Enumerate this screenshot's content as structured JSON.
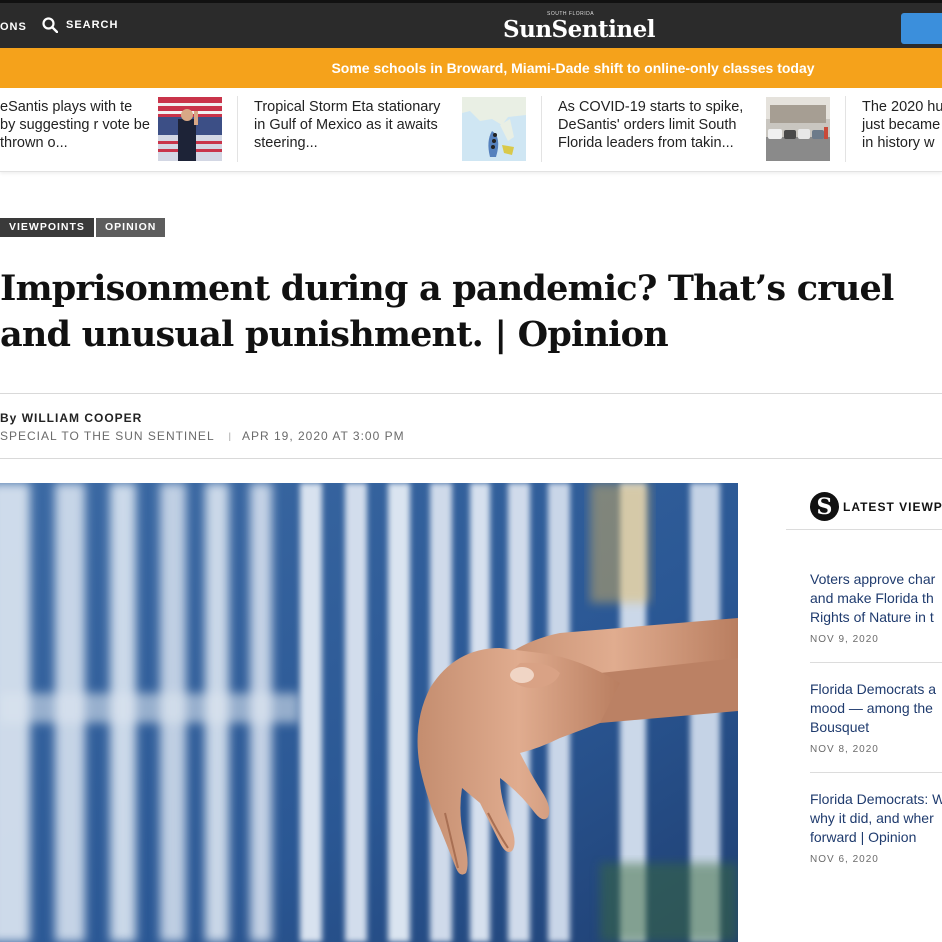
{
  "nav": {
    "sections_label": "ONS",
    "search_label": "SEARCH",
    "logo_tag": "SOUTH FLORIDA",
    "logo_text": "SunSentinel"
  },
  "banner": {
    "text": "Some schools in Broward, Miami-Dade shift to online-only classes today"
  },
  "strip": [
    {
      "text": "eSantis plays with te by suggesting r vote be thrown o..."
    },
    {
      "text": "Tropical Storm Eta stationary in Gulf of Mexico as it awaits steering..."
    },
    {
      "text": "As COVID-19 starts to spike, DeSantis' orders limit South Florida leaders from takin..."
    },
    {
      "text": "The 2020 hu just became in history w"
    }
  ],
  "article": {
    "tags": [
      "VIEWPOINTS",
      "OPINION"
    ],
    "headline": "Imprisonment during a pandemic? That’s cruel and unusual punishment. | Opinion",
    "byline_by": "By",
    "author": "WILLIAM COOPER",
    "source": "SPECIAL TO THE SUN SENTINEL",
    "separator": "|",
    "date": "APR 19, 2020 AT 3:00 PM"
  },
  "sidebar": {
    "logo_letter": "S",
    "title": "LATEST VIEWPO",
    "items": [
      {
        "title_lines": [
          "Voters approve char",
          "and make Florida th",
          "Rights of Nature in t"
        ],
        "date": "NOV 9, 2020"
      },
      {
        "title_lines": [
          "Florida Democrats a",
          "mood — among the",
          "Bousquet"
        ],
        "date": "NOV 8, 2020"
      },
      {
        "title_lines": [
          "Florida Democrats: W",
          "why it did, and wher",
          "forward | Opinion"
        ],
        "date": "NOV 6, 2020"
      }
    ]
  },
  "colors": {
    "topbar": "#2b2b2b",
    "banner": "#f5a21b",
    "link": "#1f3b6e",
    "button": "#3b8fdc"
  }
}
